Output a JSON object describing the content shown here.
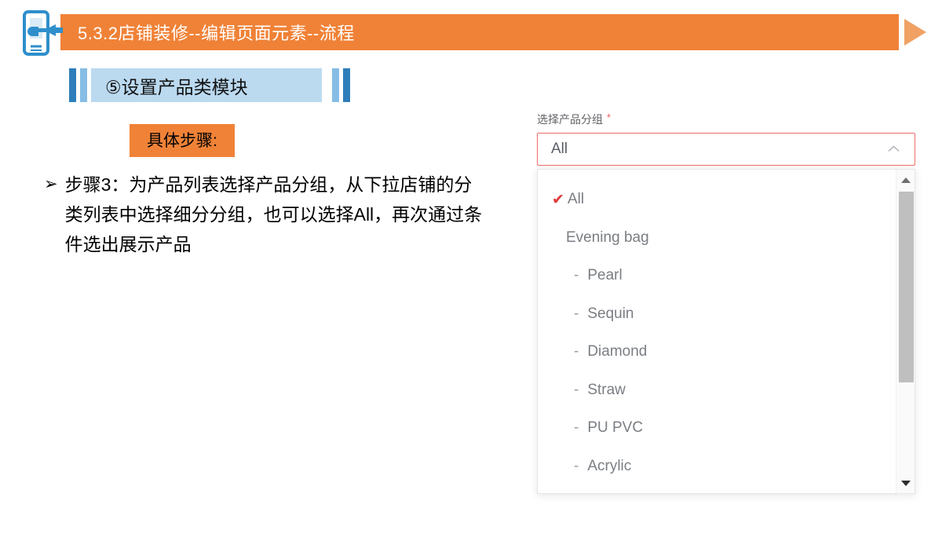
{
  "header": {
    "title": "5.3.2店铺装修--编辑页面元素--流程",
    "banner_color": "#F08237",
    "play_arrow_color": "#F0A163",
    "phone_icon": "phone-hand-icon"
  },
  "section": {
    "heading": "⑤设置产品类模块",
    "plate_color": "#BBDAF0",
    "bar_dark_color": "#2E7EBB",
    "bar_light_color": "#86BDE4"
  },
  "steps": {
    "chip_label": "具体步骤:",
    "chip_color": "#F08237",
    "bullet_marker": "➢",
    "bullet_text": "步骤3：为产品列表选择产品分组，从下拉店铺的分类列表中选择细分分组，也可以选择All，再次通过条件选出展示产品"
  },
  "dropdown": {
    "label": "选择产品分组",
    "required_mark": "*",
    "required_color": "#F25A5A",
    "border_color": "#F06B6B",
    "selected_value": "All",
    "chevron_icon": "chevron-up-icon",
    "check_color": "#E03A3A",
    "options": [
      {
        "label": "All",
        "level": 0,
        "checked": true,
        "dash": false
      },
      {
        "label": "Evening bag",
        "level": 1,
        "checked": false,
        "dash": false
      },
      {
        "label": "Pearl",
        "level": 2,
        "checked": false,
        "dash": true
      },
      {
        "label": "Sequin",
        "level": 2,
        "checked": false,
        "dash": true
      },
      {
        "label": "Diamond",
        "level": 2,
        "checked": false,
        "dash": true
      },
      {
        "label": "Straw",
        "level": 2,
        "checked": false,
        "dash": true
      },
      {
        "label": "PU PVC",
        "level": 2,
        "checked": false,
        "dash": true
      },
      {
        "label": "Acrylic",
        "level": 2,
        "checked": false,
        "dash": true
      }
    ],
    "scrollbar": {
      "up_icon": "triangle-up-icon",
      "down_icon": "triangle-down-icon",
      "thumb_color": "#BFBFBF"
    },
    "dash_glyph": "-",
    "check_glyph": "✔"
  }
}
